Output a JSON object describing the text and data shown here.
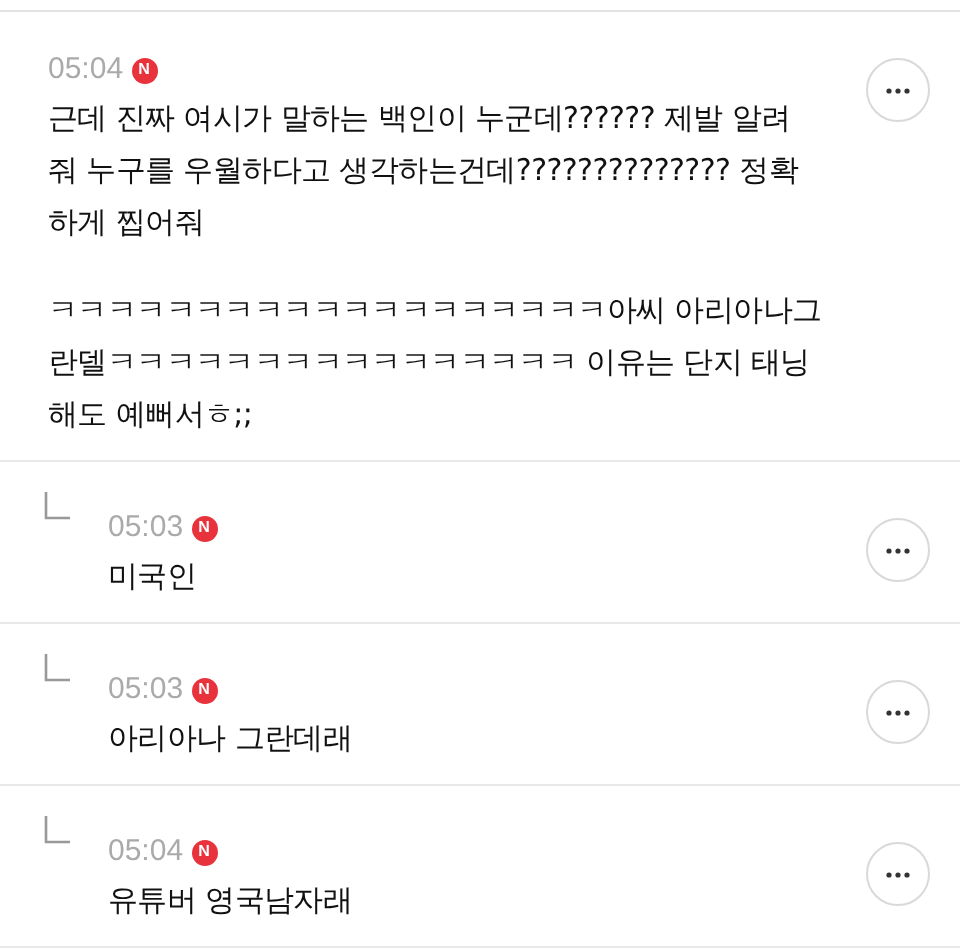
{
  "comment": {
    "time": "05:04",
    "is_new": true,
    "paragraphs": [
      [
        "근데 진짜 여시가 말하는 백인이 누군데?????? 제발 알려",
        "줘 누구를 우월하다고 생각하는건데?????????????? 정확",
        "하게 찝어줘"
      ],
      [
        "ㅋㅋㅋㅋㅋㅋㅋㅋㅋㅋㅋㅋㅋㅋㅋㅋㅋㅋㅋ아씨 아리아나그",
        "란델ㅋㅋㅋㅋㅋㅋㅋㅋㅋㅋㅋㅋㅋㅋㅋㅋ 이유는 단지 태닝",
        "해도 예뻐서ㅎ;;"
      ]
    ],
    "new_badge": "N"
  },
  "replies": [
    {
      "time": "05:03",
      "is_new": true,
      "new_badge": "N",
      "text": "미국인"
    },
    {
      "time": "05:03",
      "is_new": true,
      "new_badge": "N",
      "text": "아리아나 그란데래"
    },
    {
      "time": "05:04",
      "is_new": true,
      "new_badge": "N",
      "text": "유튜버 영국남자래"
    }
  ]
}
